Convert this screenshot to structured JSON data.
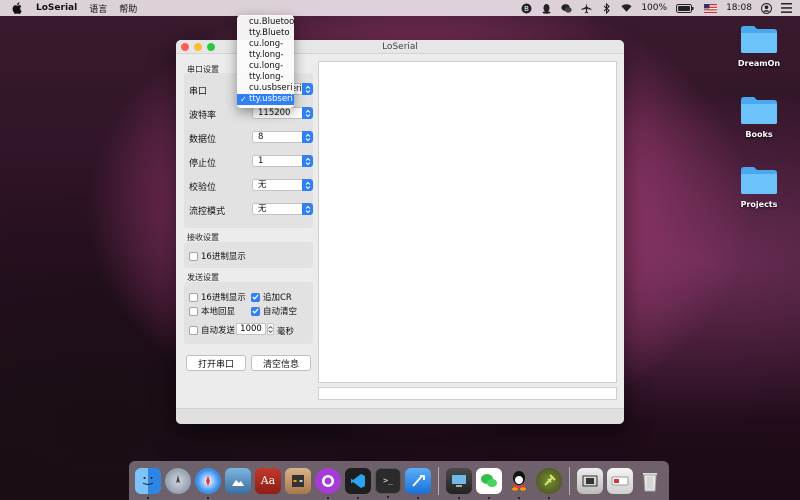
{
  "menubar": {
    "app_name": "LoSerial",
    "menus": [
      "语言",
      "帮助"
    ],
    "battery": "100%",
    "time": "18:08"
  },
  "window": {
    "title": "LoSerial",
    "serial_settings": {
      "group_label": "串口设置",
      "port_label": "串口",
      "baud_label": "波特率",
      "baud_value": "115200",
      "databits_label": "数据位",
      "databits_value": "8",
      "stopbits_label": "停止位",
      "stopbits_value": "1",
      "parity_label": "校验位",
      "parity_value": "无",
      "flow_label": "流控模式",
      "flow_value": "无"
    },
    "receive_settings": {
      "group_label": "接收设置",
      "hex_display": "16进制显示",
      "hex_checked": false
    },
    "send_settings": {
      "group_label": "发送设置",
      "hex_display": "16进制显示",
      "hex_checked": false,
      "append_cr": "追加CR",
      "append_cr_checked": true,
      "local_echo": "本地回显",
      "local_echo_checked": false,
      "auto_clear": "自动清空",
      "auto_clear_checked": true,
      "auto_send": "自动发送",
      "auto_send_checked": false,
      "interval_value": "1000",
      "interval_unit": "毫秒"
    },
    "buttons": {
      "open_port": "打开串口",
      "clear_info": "清空信息"
    }
  },
  "port_dropdown": {
    "items": [
      "cu.Bluetoo",
      "tty.Blueto",
      "cu.long-",
      "tty.long-",
      "cu.long-",
      "tty.long-",
      "cu.usbseri",
      "tty.usbseri"
    ],
    "selected_index": 7
  },
  "desktop": {
    "icons": [
      "DreamOn",
      "Books",
      "Projects"
    ]
  },
  "colors": {
    "accent": "#2f7ff5",
    "folder": "#5cb8f6"
  }
}
